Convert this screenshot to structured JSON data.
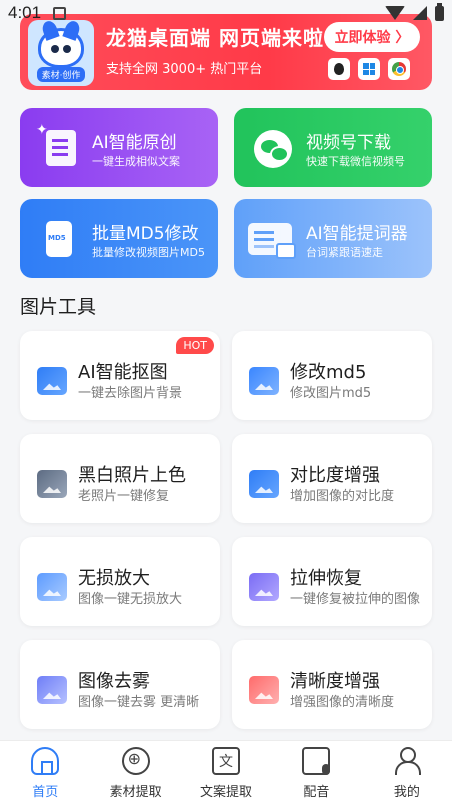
{
  "status_bar": {
    "time": "4:01"
  },
  "banner": {
    "mascot_label": "素材·创作",
    "title": "龙猫桌面端 网页端来啦",
    "subtitle": "支持全网 3000+ 热门平台",
    "cta": "立即体验 〉",
    "platforms": [
      "apple-icon",
      "windows-icon",
      "chrome-icon"
    ]
  },
  "features": [
    {
      "title": "AI智能原创",
      "desc": "一键生成相似文案",
      "icon": "ai-document-icon",
      "color": "#8a3cf0"
    },
    {
      "title": "视频号下载",
      "desc": "快速下载微信视频号",
      "icon": "wechat-icon",
      "color": "#21c35b"
    },
    {
      "title": "批量MD5修改",
      "desc": "批量修改视频图片MD5",
      "icon": "md5-file-icon",
      "color": "#2f7df6"
    },
    {
      "title": "AI智能提词器",
      "desc": "台词紧跟语速走",
      "icon": "teleprompter-icon",
      "color": "#5fa0f9"
    }
  ],
  "md5_icon_text": "MD5",
  "section": {
    "title": "图片工具"
  },
  "tools": [
    {
      "title": "AI智能抠图",
      "desc": "一键去除图片背景",
      "badge": "HOT",
      "icon": "cutout-icon"
    },
    {
      "title": "修改md5",
      "desc": "修改图片md5",
      "icon": "md5-image-icon"
    },
    {
      "title": "黑白照片上色",
      "desc": "老照片一键修复",
      "icon": "colorize-icon"
    },
    {
      "title": "对比度增强",
      "desc": "增加图像的对比度",
      "icon": "contrast-icon"
    },
    {
      "title": "无损放大",
      "desc": "图像一键无损放大",
      "icon": "upscale-icon"
    },
    {
      "title": "拉伸恢复",
      "desc": "一键修复被拉伸的图像",
      "icon": "stretch-restore-icon"
    },
    {
      "title": "图像去雾",
      "desc": "图像一键去雾 更清晰",
      "icon": "dehaze-icon"
    },
    {
      "title": "清晰度增强",
      "desc": "增强图像的清晰度",
      "icon": "hd-enhance-icon"
    }
  ],
  "bottom_nav": [
    {
      "label": "首页",
      "active": true,
      "icon": "home-icon"
    },
    {
      "label": "素材提取",
      "icon": "material-extract-icon"
    },
    {
      "label": "文案提取",
      "icon": "text-extract-icon",
      "glyph": "文"
    },
    {
      "label": "配音",
      "icon": "dubbing-icon"
    },
    {
      "label": "我的",
      "icon": "profile-icon"
    }
  ],
  "colors": {
    "accent": "#2f7df6",
    "banner": "#ff3a48",
    "hot": "#ff4a4a"
  }
}
